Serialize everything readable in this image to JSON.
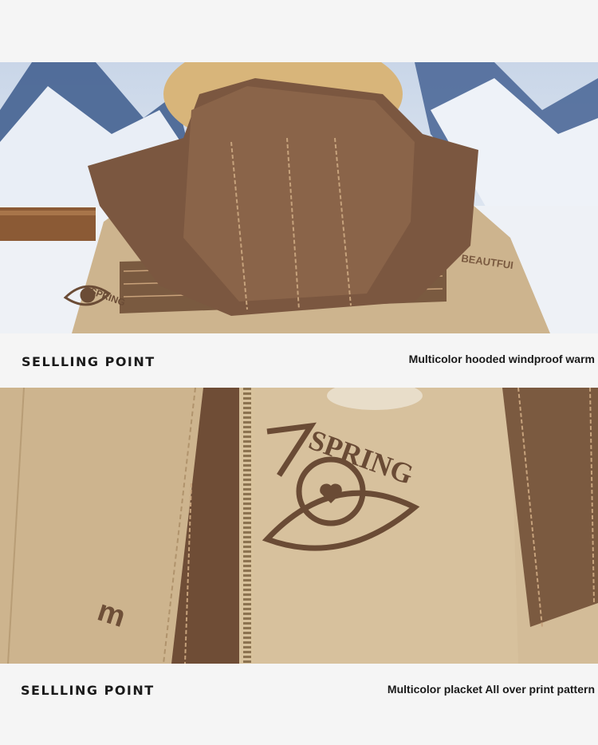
{
  "sections": [
    {
      "label": "SELLLING POINT",
      "description": "Multicolor hooded windproof warm",
      "photo_icon": "hooded-jacket-back-photo",
      "print_text": "BEAUTFUI"
    },
    {
      "label": "SELLLING POINT",
      "description": "Multicolor placket All over print pattern",
      "photo_icon": "spring-eye-print-closeup-photo",
      "print_text": "SPRING"
    }
  ],
  "colors": {
    "khaki": "#cdb48e",
    "brown": "#7a5a40",
    "dark_brown": "#5e4330",
    "snow": "#e8eef6",
    "mountain_blue": "#3c5a8c"
  }
}
